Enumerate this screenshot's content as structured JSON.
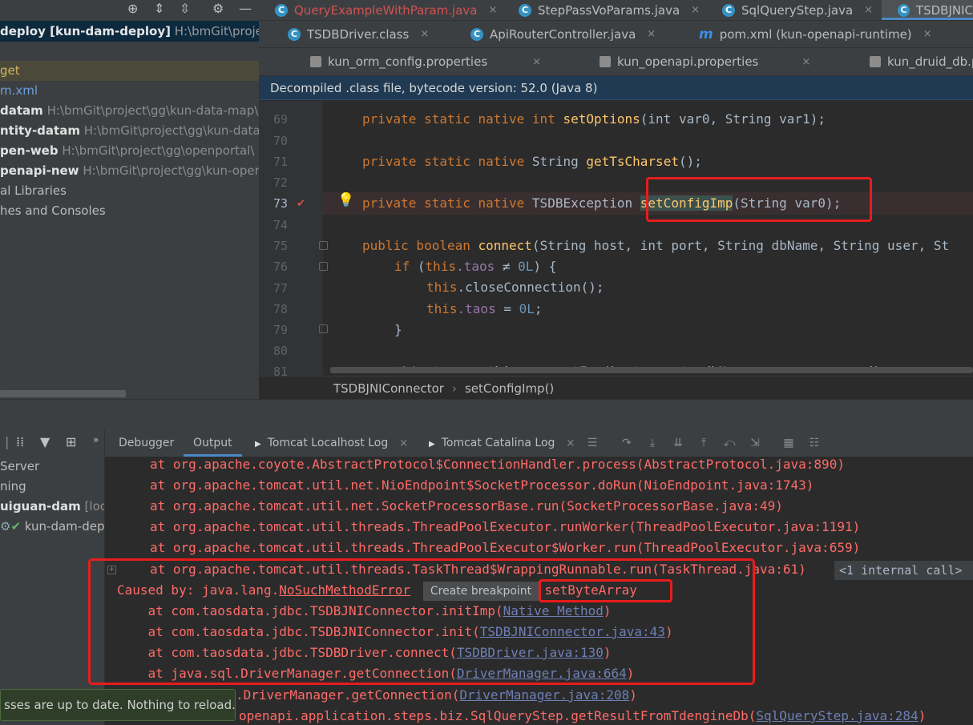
{
  "project": {
    "title_bold": "deploy [kun-dam-deploy]",
    "title_path": "H:\\bmGit\\project",
    "rows": [
      {
        "name": "get",
        "path": ""
      },
      {
        "name": "m.xml",
        "path": ""
      },
      {
        "name": "datam",
        "path": "H:\\bmGit\\project\\gg\\kun-data-map\\ku"
      },
      {
        "name": "ntity-datam",
        "path": "H:\\bmGit\\project\\gg\\kun-data-"
      },
      {
        "name": "pen-web",
        "path": "H:\\bmGit\\project\\gg\\openportal\\"
      },
      {
        "name": "penapi-new",
        "path": "H:\\bmGit\\project\\gg\\kun-oper"
      },
      {
        "name": "al Libraries",
        "path": ""
      },
      {
        "name": "hes and Consoles",
        "path": ""
      }
    ]
  },
  "editor_tabs": {
    "row1": [
      {
        "label": "QueryExampleWithParam.java",
        "close": "×"
      },
      {
        "label": "StepPassVoParams.java",
        "close": "×"
      },
      {
        "label": "SqlQueryStep.java",
        "close": "×"
      },
      {
        "label": "TSDBJNIC",
        "close": ""
      }
    ],
    "row2": [
      {
        "label": "TSDBDriver.class",
        "close": "×"
      },
      {
        "label": "ApiRouterController.java",
        "close": "×"
      },
      {
        "label": "pom.xml (kun-openapi-runtime)",
        "close": "×"
      }
    ],
    "row3": [
      {
        "label": "kun_orm_config.properties",
        "close": "×"
      },
      {
        "label": "kun_openapi.properties",
        "close": "×"
      },
      {
        "label": "kun_druid_db.p",
        "close": ""
      }
    ]
  },
  "banner": "Decompiled .class file, bytecode version: 52.0 (Java 8)",
  "code": {
    "line_numbers": [
      "69",
      "70",
      "71",
      "72",
      "73",
      "74",
      "75",
      "76",
      "77",
      "78",
      "79",
      "80",
      "81"
    ],
    "lines": {
      "l69": {
        "kw": "private static native int ",
        "fn": "setOptions",
        "rest": "(int var0, String var1);"
      },
      "l71": {
        "kw": "private static native ",
        "type": "String ",
        "fn": "getTsCharset",
        "rest": "();"
      },
      "l73": {
        "kw": "private static native ",
        "type": "TSDBException ",
        "fn": "setConfigImp",
        "rest": "(String var0);"
      },
      "l75": {
        "kw": "public boolean ",
        "fn": "connect",
        "rest": "(String host, int port, String dbName, String user, St"
      },
      "l76": {
        "kw": "if ",
        "open": "(",
        "this": "this",
        "field": ".taos",
        "op": " ≠ ",
        "num": "0L",
        "rest": ") {"
      },
      "l77": {
        "this": "this",
        "rest": ".closeConnection();"
      },
      "l78": {
        "this": "this",
        "field": ".taos",
        "mid": " = ",
        "num": "0L",
        "rest": ";"
      },
      "l79": {
        "rest": "}"
      },
      "l81": {
        "this": "this",
        "field": ".taos",
        "rest": " = this.connectImp(host, port, dbName, user, password);"
      }
    }
  },
  "breadcrumbs": {
    "class": "TSDBJNIConnector",
    "method": "setConfigImp()",
    "sep": "›"
  },
  "services": {
    "rows": [
      {
        "name": "Server"
      },
      {
        "name": "ning"
      },
      {
        "name": "uiguan-dam",
        "path": "[loca"
      },
      {
        "name": "kun-dam-dep"
      }
    ]
  },
  "console_tabs": [
    {
      "label": "Debugger"
    },
    {
      "label": "Output"
    },
    {
      "label": "Tomcat Localhost Log"
    },
    {
      "label": "Tomcat Catalina Log"
    }
  ],
  "console": {
    "l1": {
      "text": "at org.apache.coyote.AbstractProtocol$ConnectionHandler.process(AbstractProtocol.java:890)"
    },
    "l2": {
      "text": "at org.apache.tomcat.util.net.NioEndpoint$SocketProcessor.doRun(NioEndpoint.java:1743)"
    },
    "l3": {
      "text": "at org.apache.tomcat.util.net.SocketProcessorBase.run(SocketProcessorBase.java:49)"
    },
    "l4": {
      "text": "at org.apache.tomcat.util.threads.ThreadPoolExecutor.runWorker(ThreadPoolExecutor.java:1191)"
    },
    "l5": {
      "text": "at org.apache.tomcat.util.threads.ThreadPoolExecutor$Worker.run(ThreadPoolExecutor.java:659)"
    },
    "l6": {
      "text": "at org.apache.tomcat.util.threads.TaskThread$WrappingRunnable.run(TaskThread.java:61)"
    },
    "internal_call": "<1 internal call>",
    "caused": {
      "prefix": "Caused by: java.lang.",
      "err": "NoSuchMethodError",
      "tooltip": "Create breakpoint",
      "msg": ": setByteArray"
    },
    "l8": {
      "prefix": "    at com.taosdata.jdbc.TSDBJNIConnector.initImp(",
      "link": "Native Method",
      "suffix": ")"
    },
    "l9": {
      "prefix": "    at com.taosdata.jdbc.TSDBJNIConnector.init(",
      "link": "TSDBJNIConnector.java:43",
      "suffix": ")"
    },
    "l10": {
      "prefix": "    at com.taosdata.jdbc.TSDBDriver.connect(",
      "link": "TSDBDriver.java:130",
      "suffix": ")"
    },
    "l11": {
      "prefix": "    at java.sql.DriverManager.getConnection(",
      "link": "DriverManager.java:664",
      "suffix": ")"
    },
    "l12": {
      "prefix": ".DriverManager.getConnection(",
      "link": "DriverManager.java:208",
      "suffix": ")"
    },
    "l13": {
      "prefix": "openapi.application.steps.biz.SqlQueryStep.getResultFromTdengineDb(",
      "link": "SqlQueryStep.java:284",
      "suffix": ")"
    }
  },
  "notification": "sses are up to date. Nothing to reload."
}
